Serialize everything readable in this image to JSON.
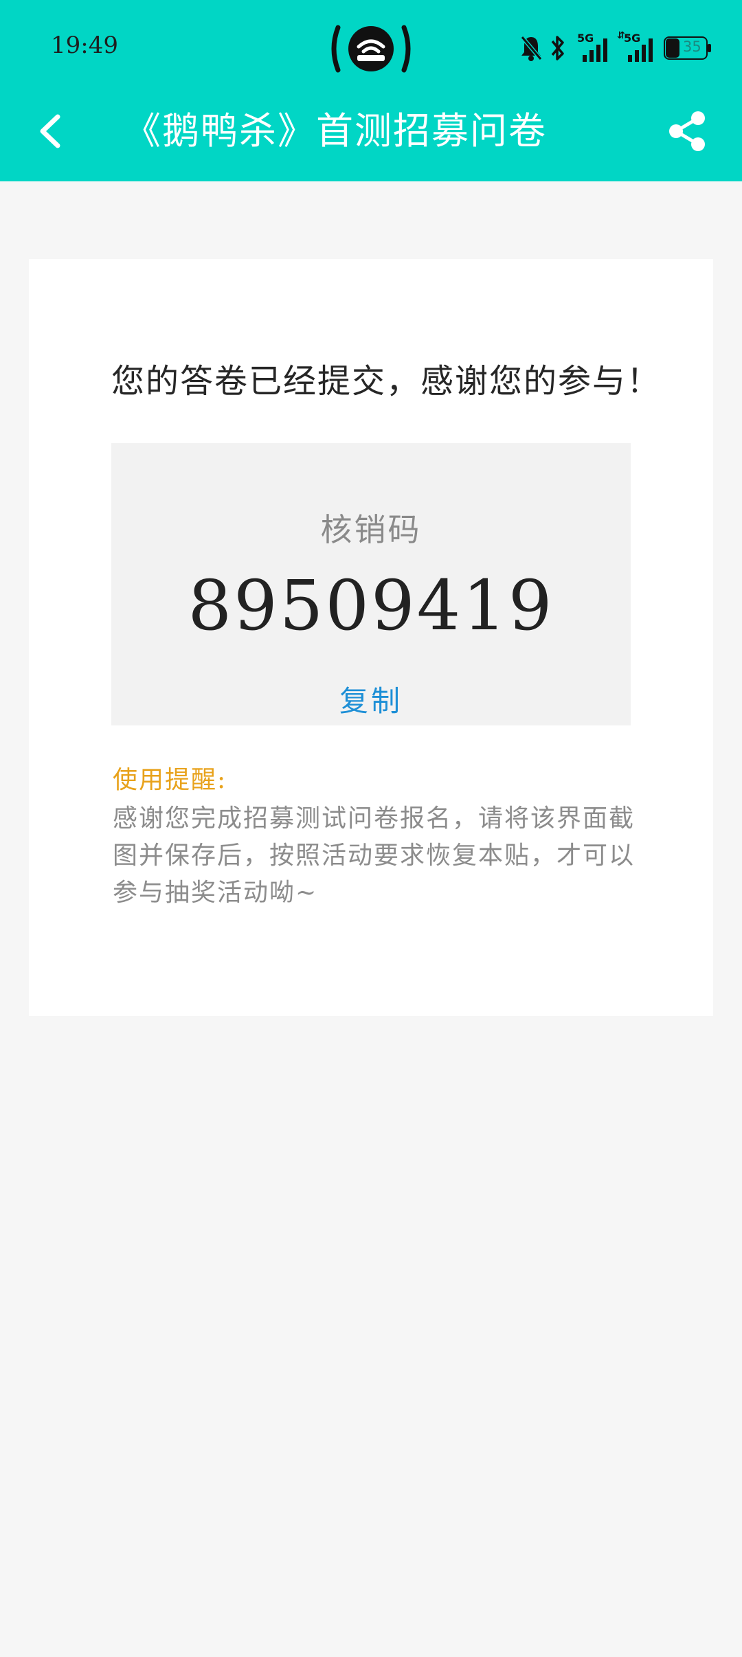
{
  "status_bar": {
    "time": "19:49",
    "battery_level": "35",
    "icons": [
      "hotspot-icon",
      "bell-muted-icon",
      "bluetooth-icon",
      "signal-5g-icon",
      "signal-5g-data-icon",
      "battery-icon"
    ],
    "network_label_1": "5G",
    "network_label_2": "5G"
  },
  "title_bar": {
    "title": "《鹅鸭杀》首测招募问卷",
    "background_color": "#01d6c5",
    "back_icon": "chevron-left-icon",
    "share_icon": "share-icon"
  },
  "result": {
    "message": "您的答卷已经提交，感谢您的参与！",
    "code_label": "核销码",
    "code_value": "89509419",
    "copy_label": "复制",
    "copy_color": "#1d8fd6"
  },
  "tips": {
    "title": "使用提醒:",
    "title_color": "#e8a21b",
    "body": "感谢您完成招募测试问卷报名，请将该界面截图并保存后，按照活动要求恢复本贴，才可以参与抽奖活动呦~"
  }
}
